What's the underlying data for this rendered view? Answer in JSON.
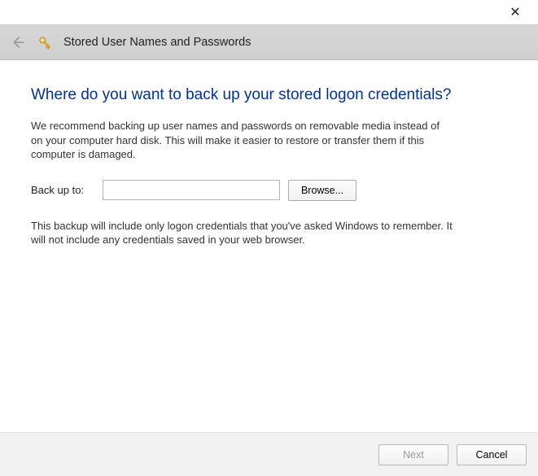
{
  "titlebar": {
    "close_label": "✕"
  },
  "header": {
    "title": "Stored User Names and Passwords"
  },
  "main": {
    "heading": "Where do you want to back up your stored logon credentials?",
    "intro": "We recommend backing up user names and passwords on removable media instead of on your computer hard disk. This will make it easier to restore or transfer them if this computer is damaged.",
    "backup_label": "Back up to:",
    "backup_value": "",
    "browse_label": "Browse...",
    "note": "This backup will include only logon credentials that you've asked Windows to remember. It will not include any credentials saved in your web browser."
  },
  "footer": {
    "next_label": "Next",
    "cancel_label": "Cancel"
  }
}
